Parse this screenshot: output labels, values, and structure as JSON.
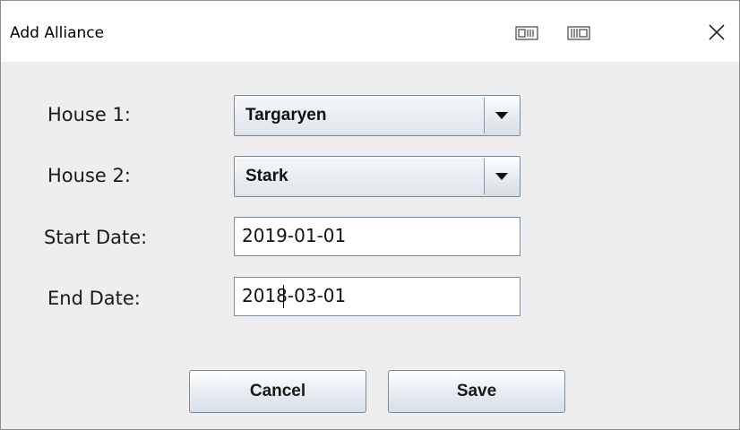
{
  "window": {
    "title": "Add Alliance"
  },
  "form": {
    "house1": {
      "label": "House 1:",
      "value": "Targaryen"
    },
    "house2": {
      "label": "House 2:",
      "value": "Stark"
    },
    "start_date": {
      "label": "Start Date:",
      "value": "2019-01-01"
    },
    "end_date": {
      "label": "End Date:",
      "value": "2018-03-01"
    }
  },
  "buttons": {
    "cancel": "Cancel",
    "save": "Save"
  },
  "icons": {
    "titlebar_left": "window-layout-icon",
    "titlebar_right": "split-view-icon",
    "close": "close-icon",
    "dropdown": "triangle-down-icon"
  }
}
